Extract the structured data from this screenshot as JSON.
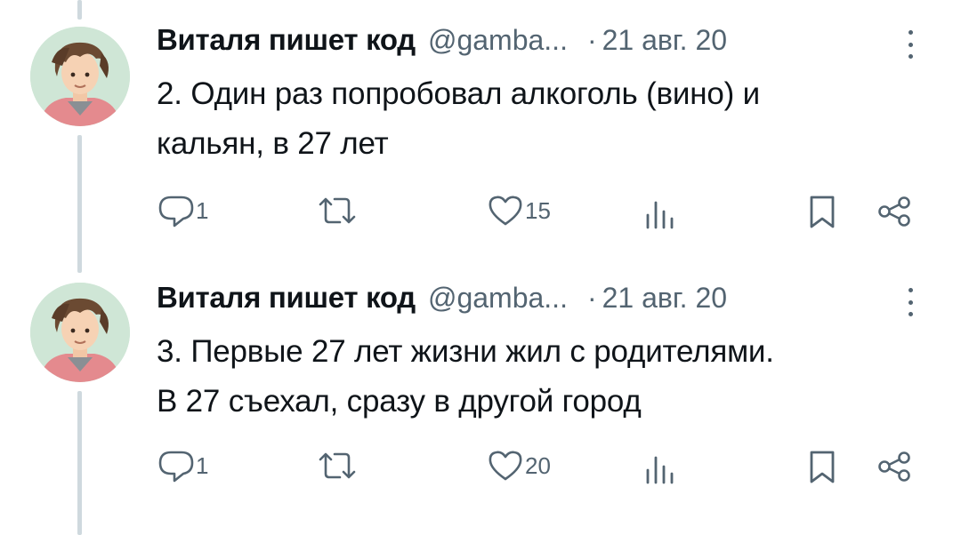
{
  "tweets": [
    {
      "author_name": "Виталя пишет код",
      "handle": "@gamba...",
      "separator": "·",
      "date": "21 авг. 20",
      "text_line1": "2. Один раз попробовал алкоголь (вино) и",
      "text_line2": "кальян, в 27 лет",
      "reply_count": "1",
      "retweet_count": "",
      "like_count": "15"
    },
    {
      "author_name": "Виталя пишет код",
      "handle": "@gamba...",
      "separator": "·",
      "date": "21 авг. 20",
      "text_line1": "3. Первые 27 лет жизни жил с родителями.",
      "text_line2": "В 27 съехал, сразу в другой город",
      "reply_count": "1",
      "retweet_count": "",
      "like_count": "20"
    }
  ],
  "colors": {
    "text_primary": "#0f1419",
    "text_secondary": "#536471",
    "thread_line": "#cfd9de"
  },
  "icons": [
    "reply-icon",
    "retweet-icon",
    "like-icon",
    "views-icon",
    "bookmark-icon",
    "share-icon",
    "more-icon"
  ]
}
